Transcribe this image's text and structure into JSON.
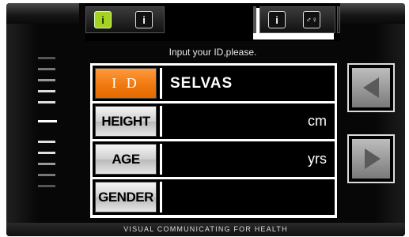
{
  "header": {
    "title": "I D",
    "icons": [
      "person-id-icon",
      "number-one-icon",
      "chart-icon",
      "gender-icon"
    ],
    "icon_glyphs": [
      "i",
      "i",
      "i",
      "♂♀"
    ]
  },
  "prompt": "Input your ID,please.",
  "fields": {
    "id": {
      "label": "I D",
      "value": "SELVAS",
      "unit": ""
    },
    "height": {
      "label": "HEIGHT",
      "value": "",
      "unit": "cm"
    },
    "age": {
      "label": "AGE",
      "value": "",
      "unit": "yrs"
    },
    "gender": {
      "label": "GENDER",
      "value": "",
      "unit": ""
    }
  },
  "footer": "VISUAL COMMUNICATING FOR HEALTH",
  "colors": {
    "selected": "#f07a10",
    "active_icon": "#a6d321",
    "background": "#0c0c0c"
  }
}
